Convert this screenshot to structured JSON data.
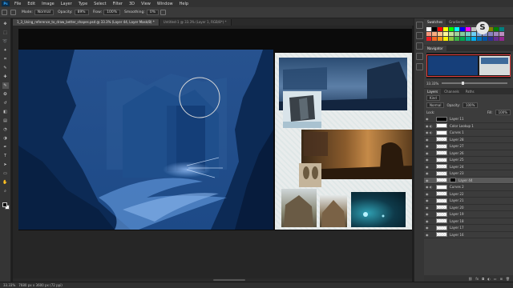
{
  "menubar": {
    "app_icon": "Ps",
    "items": [
      "File",
      "Edit",
      "Image",
      "Layer",
      "Type",
      "Select",
      "Filter",
      "3D",
      "View",
      "Window",
      "Help"
    ]
  },
  "options": {
    "mode_label": "Mode:",
    "mode_value": "Normal",
    "opacity_label": "Opacity:",
    "opacity_value": "89%",
    "flow_label": "Flow:",
    "flow_value": "100%",
    "smoothing_label": "Smoothing:",
    "smoothing_value": "0%"
  },
  "tabs": [
    {
      "label": "1_3_Using_reference_to_draw_better_shapes.psd @ 33.3% (Layer 44, Layer Mask/8) *"
    },
    {
      "label": "Untitled-1 @ 33.3% (Layer 1, RGB/8*) *"
    }
  ],
  "status": {
    "zoom": "33.33%",
    "doc": "7680 px x 3600 px (72 ppi)"
  },
  "panels": {
    "swatches_tab": "Swatches",
    "gradients_tab": "Gradients",
    "navigator_tab": "Navigator",
    "nav_zoom": "33.33%",
    "layers_tab": "Layers",
    "channels_tab": "Channels",
    "paths_tab": "Paths",
    "kind_label": "Kind",
    "blend_value": "Normal",
    "opacity_label": "Opacity:",
    "opacity_value": "100%",
    "lock_label": "Lock:",
    "fill_label": "Fill:",
    "fill_value": "100%",
    "swatch_colors": [
      "#ffffff",
      "#000000",
      "#ff0000",
      "#ffff00",
      "#00ff00",
      "#00ffff",
      "#0000ff",
      "#ff00ff",
      "#c0c0c0",
      "#808080",
      "#800000",
      "#808000",
      "#008000",
      "#008080",
      "#f7977a",
      "#f9ad81",
      "#fdc68a",
      "#fff79a",
      "#c4df9b",
      "#a2d39c",
      "#82ca9d",
      "#7bcdc8",
      "#6ecff6",
      "#7ea7d8",
      "#8493ca",
      "#8882be",
      "#a187be",
      "#bc8dbf",
      "#ed1c24",
      "#f26522",
      "#f7941d",
      "#fff200",
      "#8dc63f",
      "#39b54a",
      "#00a651",
      "#00a99d",
      "#00aeef",
      "#0072bc",
      "#0054a6",
      "#2e3192",
      "#662d91",
      "#92278f"
    ],
    "layers": [
      {
        "name": "Layer 11",
        "thumb": "black",
        "selected": false,
        "fx": ""
      },
      {
        "name": "Color Lookup 1",
        "thumb": "white",
        "selected": false,
        "fx": "◐"
      },
      {
        "name": "Curves 1",
        "thumb": "white",
        "selected": false,
        "fx": "◐"
      },
      {
        "name": "Layer 28",
        "thumb": "checker",
        "selected": false,
        "fx": ""
      },
      {
        "name": "Layer 27",
        "thumb": "checker",
        "selected": false,
        "fx": ""
      },
      {
        "name": "Layer 26",
        "thumb": "checker",
        "selected": false,
        "fx": ""
      },
      {
        "name": "Layer 25",
        "thumb": "checker",
        "selected": false,
        "fx": ""
      },
      {
        "name": "Layer 24",
        "thumb": "checker",
        "selected": false,
        "fx": ""
      },
      {
        "name": "Layer 23",
        "thumb": "checker",
        "selected": false,
        "fx": ""
      },
      {
        "name": "Layer 44",
        "thumb": "checker",
        "selected": true,
        "fx": ""
      },
      {
        "name": "Curves 2",
        "thumb": "white",
        "selected": false,
        "fx": "◐"
      },
      {
        "name": "Layer 22",
        "thumb": "checker",
        "selected": false,
        "fx": ""
      },
      {
        "name": "Layer 21",
        "thumb": "checker",
        "selected": false,
        "fx": ""
      },
      {
        "name": "Layer 20",
        "thumb": "checker",
        "selected": false,
        "fx": ""
      },
      {
        "name": "Layer 19",
        "thumb": "checker",
        "selected": false,
        "fx": ""
      },
      {
        "name": "Layer 18",
        "thumb": "checker",
        "selected": false,
        "fx": ""
      },
      {
        "name": "Layer 17",
        "thumb": "checker",
        "selected": false,
        "fx": ""
      },
      {
        "name": "Layer 16",
        "thumb": "checker",
        "selected": false,
        "fx": ""
      }
    ]
  },
  "tools": [
    "move-icon",
    "marquee-icon",
    "lasso-icon",
    "wand-icon",
    "crop-icon",
    "eyedropper-icon",
    "healing-icon",
    "brush-icon",
    "stamp-icon",
    "history-brush-icon",
    "eraser-icon",
    "gradient-icon",
    "blur-icon",
    "dodge-icon",
    "pen-icon",
    "type-icon",
    "path-select-icon",
    "shape-icon",
    "hand-icon",
    "zoom-icon"
  ],
  "tool_glyphs": [
    "✥",
    "⬚",
    "➰",
    "✦",
    "⌗",
    "✎",
    "✚",
    "✎",
    "✪",
    "↺",
    "◧",
    "▤",
    "◔",
    "◑",
    "✒",
    "T",
    "➤",
    "▭",
    "✋",
    "⌕"
  ],
  "watermark": "S"
}
